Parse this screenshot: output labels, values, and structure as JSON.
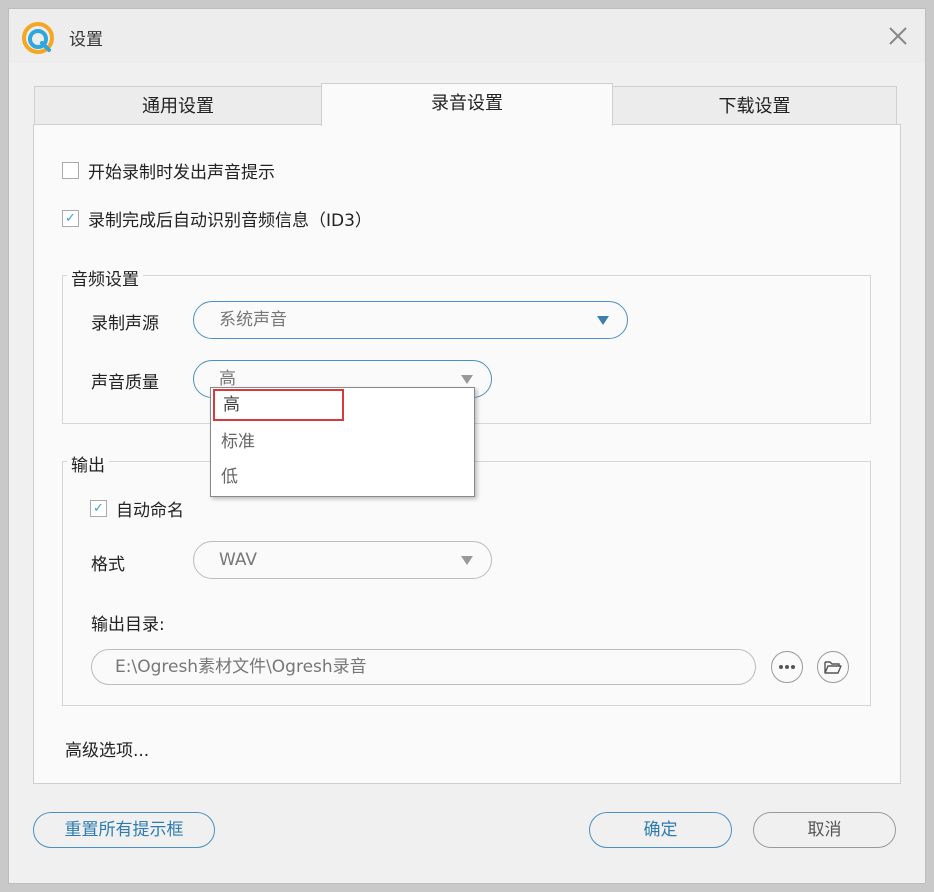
{
  "window": {
    "title": "设置"
  },
  "tabs": [
    {
      "label": "通用设置",
      "active": false
    },
    {
      "label": "录音设置",
      "active": true
    },
    {
      "label": "下载设置",
      "active": false
    }
  ],
  "options": {
    "sound_prompt": {
      "label": "开始录制时发出声音提示",
      "checked": false
    },
    "auto_id3": {
      "label": "录制完成后自动识别音频信息（ID3）",
      "checked": true
    }
  },
  "audio_settings": {
    "title": "音频设置",
    "source_label": "录制声源",
    "source_value": "系统声音",
    "quality_label": "声音质量",
    "quality_value": "高",
    "quality_options": [
      "高",
      "标准",
      "低"
    ]
  },
  "output": {
    "title": "输出",
    "auto_name": {
      "label": "自动命名",
      "checked": true
    },
    "format_label": "格式",
    "format_value": "WAV",
    "dir_label": "输出目录:",
    "dir_value": "E:\\Ogresh素材文件\\Ogresh录音"
  },
  "advanced_link": "高级选项...",
  "buttons": {
    "reset": "重置所有提示框",
    "ok": "确定",
    "cancel": "取消"
  },
  "colors": {
    "accent": "#4a90c0",
    "highlight": "#d9393a"
  }
}
